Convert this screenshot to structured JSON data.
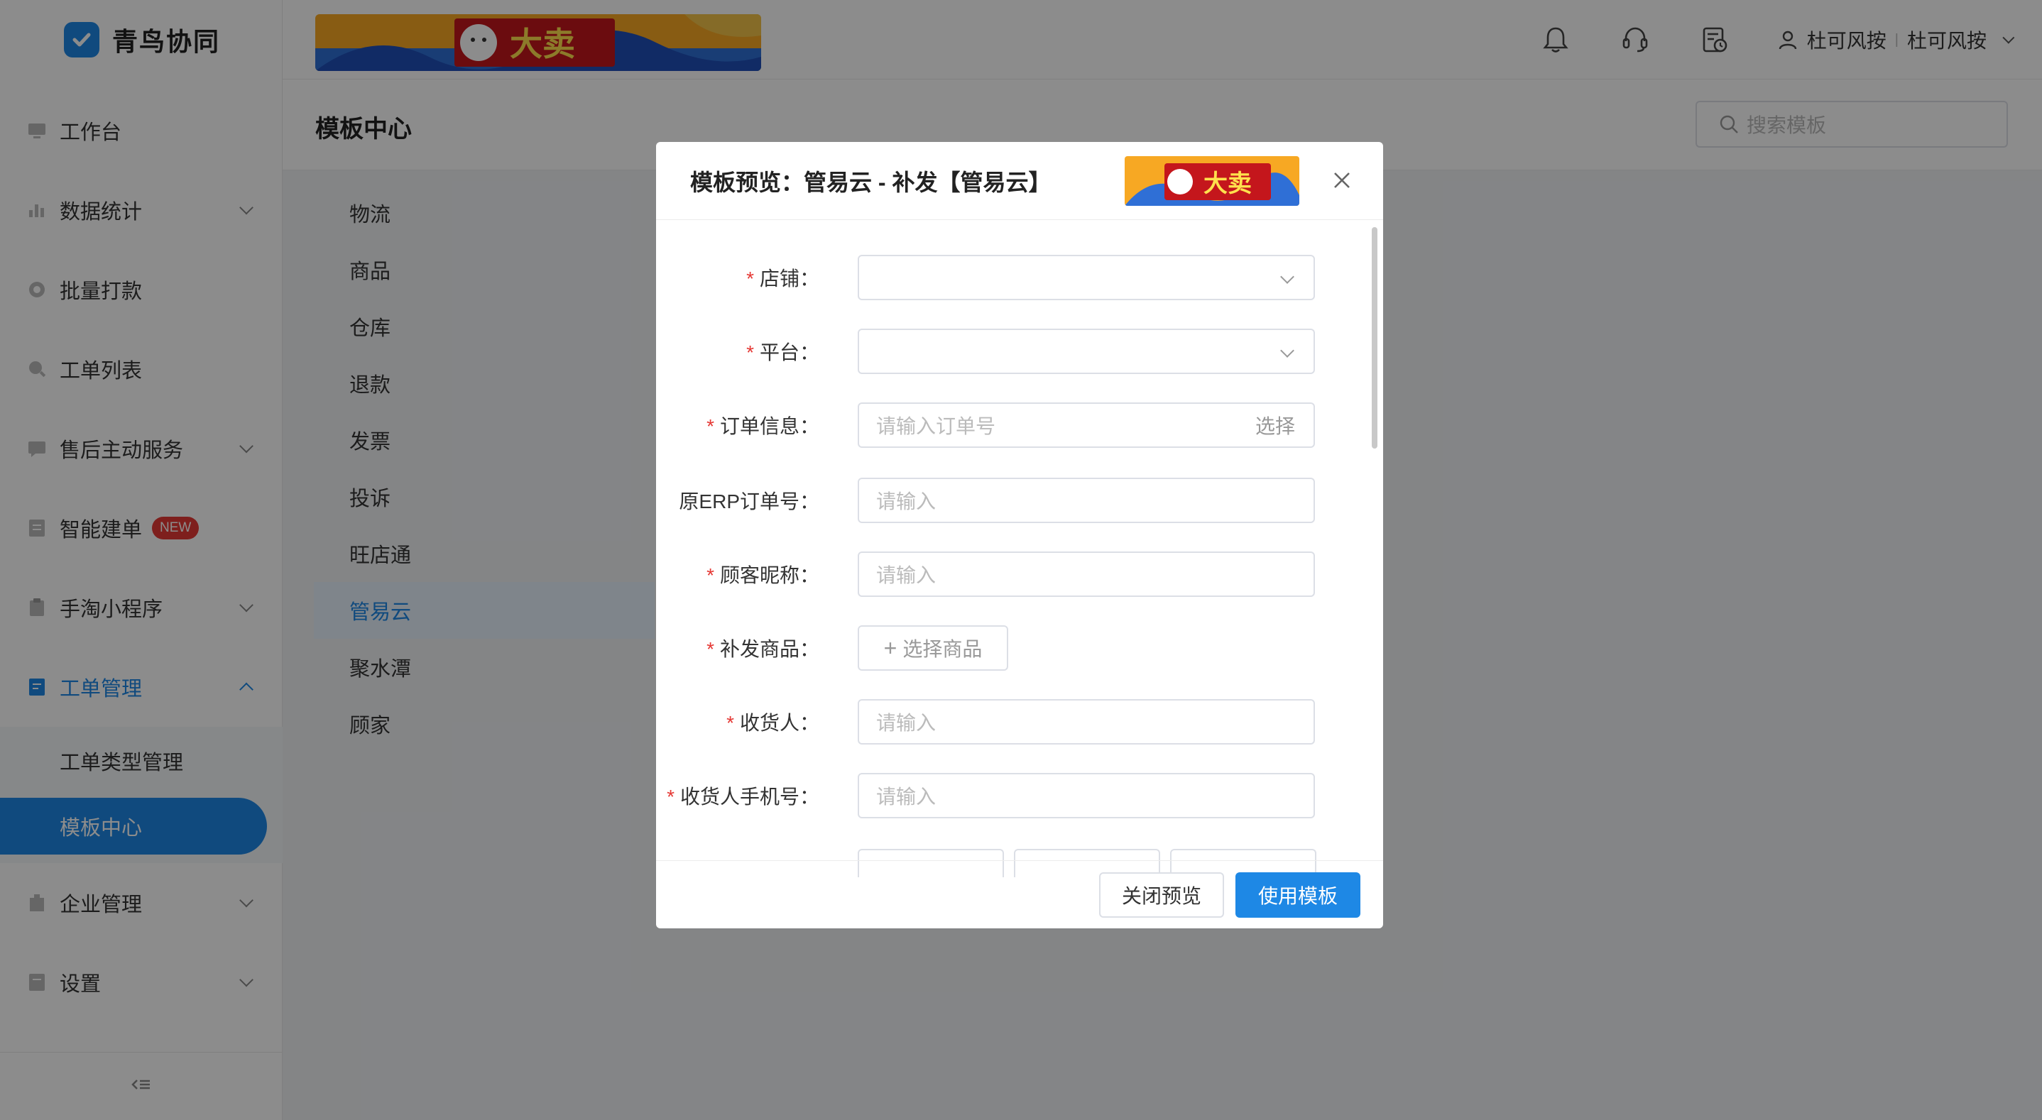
{
  "app": {
    "name": "青鸟协同"
  },
  "sidebar": {
    "items": [
      {
        "label": "工作台",
        "icon": "monitor-icon",
        "has_children": false
      },
      {
        "label": "数据统计",
        "icon": "bar-chart-icon",
        "has_children": true
      },
      {
        "label": "批量打款",
        "icon": "coin-icon",
        "has_children": false
      },
      {
        "label": "工单列表",
        "icon": "search-list-icon",
        "has_children": false
      },
      {
        "label": "售后主动服务",
        "icon": "chat-icon",
        "has_children": true
      },
      {
        "label": "智能建单",
        "icon": "doc-icon",
        "has_children": false,
        "badge": "NEW"
      },
      {
        "label": "手淘小程序",
        "icon": "clipboard-icon",
        "has_children": true
      },
      {
        "label": "工单管理",
        "icon": "edit-doc-icon",
        "has_children": true,
        "expanded": true,
        "active": true
      }
    ],
    "submenu": [
      {
        "label": "工单类型管理"
      },
      {
        "label": "模板中心",
        "selected": true
      }
    ],
    "items_after": [
      {
        "label": "企业管理",
        "icon": "building-icon",
        "has_children": true
      },
      {
        "label": "设置",
        "icon": "settings-doc-icon",
        "has_children": true
      }
    ]
  },
  "header": {
    "banner_text": "大卖",
    "user": {
      "name": "杜可风按",
      "org": "杜可风按"
    }
  },
  "page": {
    "title": "模板中心",
    "search": {
      "placeholder": "搜索模板"
    },
    "categories": [
      "物流",
      "商品",
      "仓库",
      "退款",
      "发票",
      "投诉",
      "旺店通",
      "管易云",
      "聚水潭",
      "顾家"
    ],
    "selected_category": "管易云"
  },
  "modal": {
    "title": "模板预览：管易云 - 补发【管易云】",
    "banner_text": "大卖",
    "fields": [
      {
        "label": "店铺：",
        "required": true,
        "type": "select",
        "placeholder": ""
      },
      {
        "label": "平台：",
        "required": true,
        "type": "select",
        "placeholder": ""
      },
      {
        "label": "订单信息：",
        "required": true,
        "type": "input-select",
        "placeholder": "请输入订单号",
        "suffix": "选择"
      },
      {
        "label": "原ERP订单号：",
        "required": false,
        "type": "input",
        "placeholder": "请输入"
      },
      {
        "label": "顾客昵称：",
        "required": true,
        "type": "input",
        "placeholder": "请输入"
      },
      {
        "label": "补发商品：",
        "required": true,
        "type": "button",
        "button_label": "选择商品"
      },
      {
        "label": "收货人：",
        "required": true,
        "type": "input",
        "placeholder": "请输入"
      },
      {
        "label": "收货人手机号：",
        "required": true,
        "type": "input",
        "placeholder": "请输入"
      }
    ],
    "footer": {
      "close_label": "关闭预览",
      "use_label": "使用模板"
    }
  },
  "colors": {
    "primary": "#1e88e5",
    "danger": "#e53935",
    "badge_new": "#e53935"
  }
}
